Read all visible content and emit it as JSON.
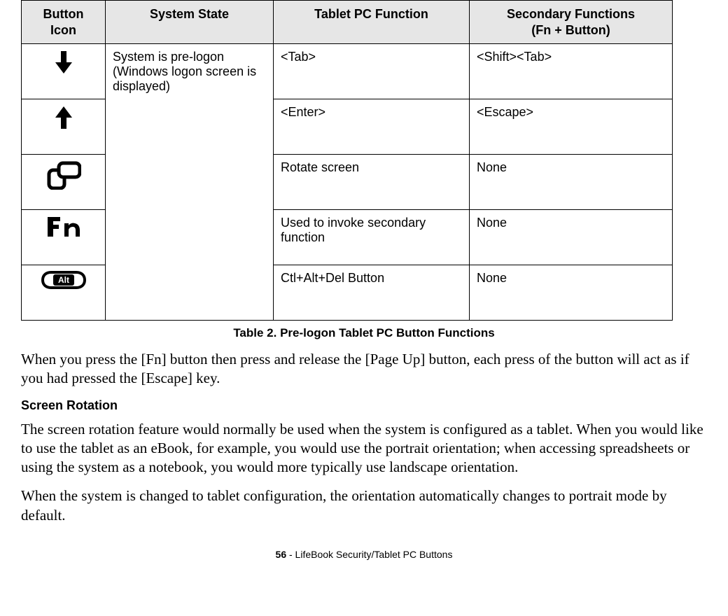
{
  "table": {
    "headers": {
      "button_icon": "Button\nIcon",
      "system_state": "System State",
      "function": "Tablet PC Function",
      "secondary": "Secondary Functions\n(Fn + Button)"
    },
    "system_state": "System is pre-logon (Windows logon screen is displayed)",
    "rows": [
      {
        "icon": "down-arrow-icon",
        "function": "<Tab>",
        "secondary": "<Shift><Tab>"
      },
      {
        "icon": "up-arrow-icon",
        "function": "<Enter>",
        "secondary": "<Escape>"
      },
      {
        "icon": "rotate-icon",
        "function": "Rotate screen",
        "secondary": "None"
      },
      {
        "icon": "fn-icon",
        "function": "Used to invoke secondary function",
        "secondary": "None"
      },
      {
        "icon": "alt-icon",
        "function": "Ctl+Alt+Del Button",
        "secondary": "None"
      }
    ],
    "caption": "Table 2.  Pre-logon Tablet PC Button Functions"
  },
  "paragraphs": {
    "p1": "When you press the [Fn] button then press and release the [Page Up] button, each press of the button will act as if you had pressed the [Escape] key.",
    "subhead": "Screen Rotation",
    "p2": "The screen rotation feature would normally be used when the system is configured as a tablet. When you would like to use the tablet as an eBook, for example, you would use the portrait orientation; when accessing spreadsheets or using the system as a notebook, you would more typically use landscape orientation.",
    "p3": "When the system is changed to tablet configuration, the orientation automatically changes to portrait mode by default."
  },
  "footer": {
    "page": "56",
    "title": " - LifeBook Security/Tablet PC Buttons"
  }
}
